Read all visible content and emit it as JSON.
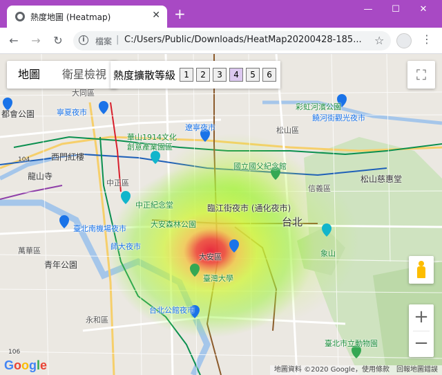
{
  "browser": {
    "tab_title": "熱度地圖 (Heatmap)",
    "tab_close": "✕",
    "new_tab": "+",
    "minimize": "—",
    "maximize": "☐",
    "close": "✕",
    "back": "←",
    "forward": "→",
    "reload": "↻",
    "info": "i",
    "file_label": "檔案",
    "separator": "|",
    "url": "C:/Users/Public/Downloads/HeatMap20200428-185...",
    "star": "☆",
    "menu": "⋮"
  },
  "map": {
    "type_map": "地圖",
    "type_satellite": "衛星檢視",
    "radius_label": "熱度擴散等級",
    "radius_levels": [
      "1",
      "2",
      "3",
      "4",
      "5",
      "6"
    ],
    "selected_radius": "4",
    "fullscreen": "⛶",
    "zoom_in": "+",
    "zoom_out": "−",
    "attribution": "地圖資料 ©2020 Google，使用條款　回報地圖錯誤",
    "labels": {
      "datong": "大同區",
      "ningxia": "寧夏夜市",
      "shimin": "都會公園",
      "huashan": "華山1914文化",
      "huashan2": "創意產業園區",
      "liaoning": "遼寧夜市",
      "songshan": "松山區",
      "raohe": "饒河街觀光夜市",
      "caoshan": "彩虹河濱公園",
      "ximen": "西門紅樓",
      "longshan": "龍山寺",
      "zhongzheng": "中正區",
      "sunyatsen": "國立國父紀念館",
      "xinyi": "信義區",
      "songshan_temple": "松山慈惠堂",
      "cks": "中正紀念堂",
      "linjiang": "臨江街夜市 (通化夜市)",
      "taipei": "台北",
      "daan_park": "大安森林公園",
      "nanjichang": "臺北南機場夜市",
      "shida": "師大夜市",
      "wanhua": "萬華區",
      "qingnian": "青年公園",
      "daan": "大安區",
      "xiangshan": "象山",
      "ntu": "臺灣大學",
      "gongguan": "台北公館夜市",
      "yonghe": "永和區",
      "zoo": "臺北市立動物園",
      "r104": "104",
      "r106": "106"
    }
  },
  "heatmap_center": "大安區",
  "google_logo": [
    "G",
    "o",
    "o",
    "g",
    "l",
    "e"
  ]
}
